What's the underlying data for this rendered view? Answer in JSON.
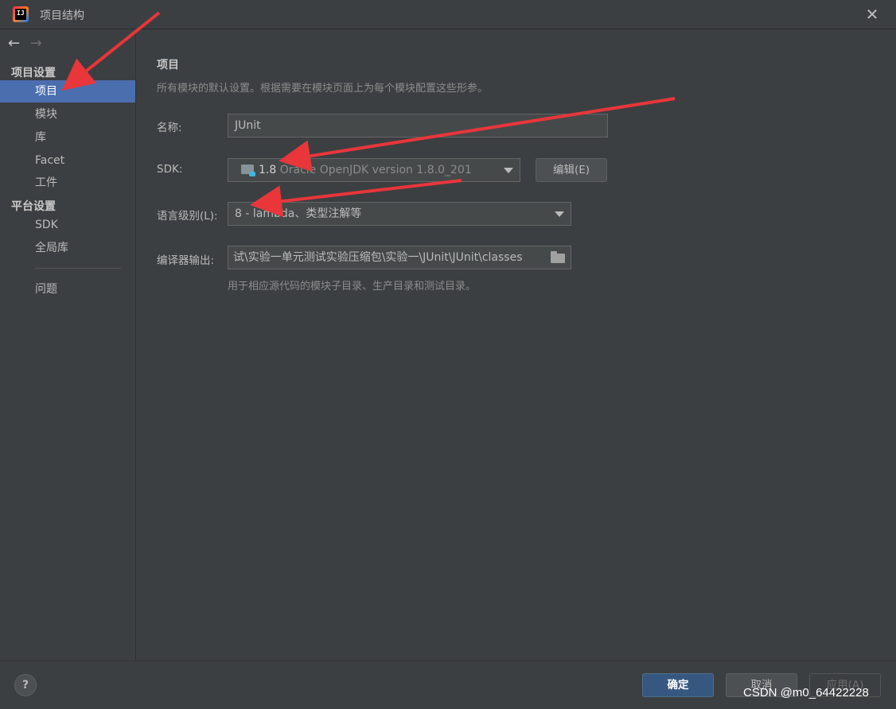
{
  "window": {
    "title": "项目结构"
  },
  "nav": {
    "back": "←",
    "forward": "→"
  },
  "sidebar": {
    "project_settings_header": "项目设置",
    "project_items": [
      "项目",
      "模块",
      "库",
      "Facet",
      "工件"
    ],
    "platform_settings_header": "平台设置",
    "platform_items": [
      "SDK",
      "全局库"
    ],
    "other_items": [
      "问题"
    ],
    "selected": "项目"
  },
  "main": {
    "heading": "项目",
    "description": "所有模块的默认设置。根据需要在模块页面上为每个模块配置这些形参。",
    "name_label": "名称:",
    "name_value": "JUnit",
    "sdk_label": "SDK:",
    "sdk_version": "1.8",
    "sdk_detail": "Oracle OpenJDK version 1.8.0_201",
    "sdk_edit_button": "编辑(E)",
    "language_level_label": "语言级别(L):",
    "language_level_value": "8 - lambda、类型注解等",
    "compiler_output_label": "编译器输出:",
    "compiler_output_value": "试\\实验一单元测试实验压缩包\\实验一\\JUnit\\JUnit\\classes",
    "compiler_output_hint": "用于相应源代码的模块子目录、生产目录和测试目录。"
  },
  "footer": {
    "help": "?",
    "ok": "确定",
    "cancel": "取消",
    "apply": "应用(A)"
  },
  "watermark": "CSDN @m0_64422228",
  "colors": {
    "selection": "#4b6eaf",
    "background": "#3c3f41",
    "annotation_arrow": "#e8363a",
    "ok_button": "#365880"
  }
}
